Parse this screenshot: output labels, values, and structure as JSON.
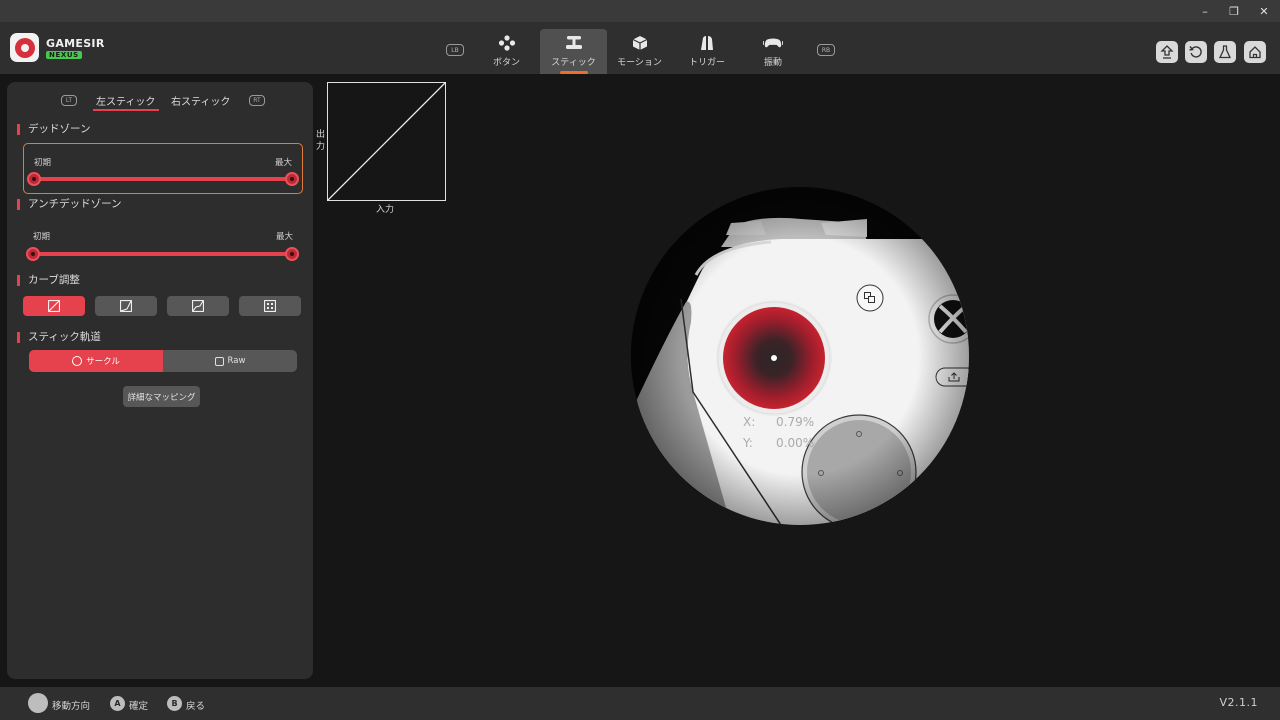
{
  "window": {
    "minimize": "–",
    "restore": "❐",
    "close": "✕"
  },
  "brand": {
    "name": "GAMESIR",
    "sub": "NEXUS"
  },
  "tabs": [
    {
      "label": "ボタン",
      "icon": "gamepad-buttons-icon"
    },
    {
      "label": "スティック",
      "icon": "joystick-icon"
    },
    {
      "label": "モーション",
      "icon": "cube-motion-icon"
    },
    {
      "label": "トリガー",
      "icon": "trigger-icon"
    },
    {
      "label": "振動",
      "icon": "controller-vibration-icon"
    }
  ],
  "bumpers": {
    "left": "LB",
    "right": "RB"
  },
  "header_actions": [
    "upload-icon",
    "reset-icon",
    "flask-icon",
    "home-icon"
  ],
  "panel": {
    "left_trigger": "LT",
    "right_trigger": "RT",
    "stick_tabs": [
      "左スティック",
      "右スティック"
    ],
    "deadzone": {
      "title": "デッドゾーン",
      "min_label": "初期",
      "max_label": "最大",
      "range": [
        0,
        100
      ]
    },
    "anti_deadzone": {
      "title": "アンチデッドゾーン",
      "min_label": "初期",
      "max_label": "最大",
      "range": [
        0,
        100
      ]
    },
    "curve": {
      "title": "カーブ調整",
      "selected": 0,
      "options": [
        "linear-curve-icon",
        "convex-curve-icon",
        "s-curve-icon",
        "custom-points-icon"
      ]
    },
    "trajectory": {
      "title": "スティック軌道",
      "circle": "サークル",
      "raw": "Raw",
      "selected": "circle"
    },
    "advanced_mapping": "詳細なマッピング"
  },
  "chart_data": {
    "type": "line",
    "xlabel": "入力",
    "ylabel": "出力",
    "x": [
      0,
      100
    ],
    "y": [
      0,
      100
    ],
    "xlim": [
      0,
      100
    ],
    "ylim": [
      0,
      100
    ]
  },
  "readout": {
    "x_label": "X:",
    "x_value": "0.79%",
    "y_label": "Y:",
    "y_value": "0.00%"
  },
  "footer": {
    "move": "移動方向",
    "a_key": "A",
    "confirm": "確定",
    "b_key": "B",
    "back": "戻る",
    "version": "V2.1.1"
  }
}
